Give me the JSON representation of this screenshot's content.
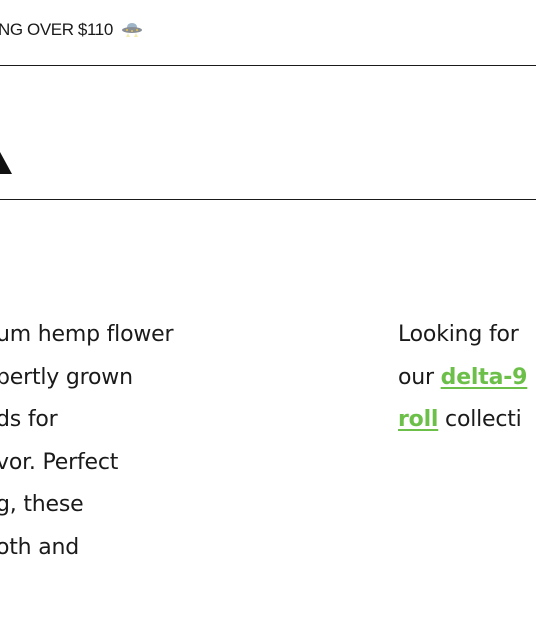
{
  "announcement": {
    "text": "NG OVER $110",
    "icon": "ufo-icon"
  },
  "header": {
    "logo_icon": "triangle-logo-icon"
  },
  "description": {
    "lines": [
      "um hemp flower",
      "pertly grown",
      "ds for",
      "vor. Perfect",
      "g, these",
      "oth and"
    ]
  },
  "related": {
    "line1_prefix": "Looking for",
    "line2_prefix": "our ",
    "link1": "delta-9",
    "link2": "roll",
    "line3_suffix": " collecti"
  },
  "colors": {
    "link_green": "#6cc04a",
    "text": "#1a1a1a",
    "border": "#1a1a1a"
  }
}
